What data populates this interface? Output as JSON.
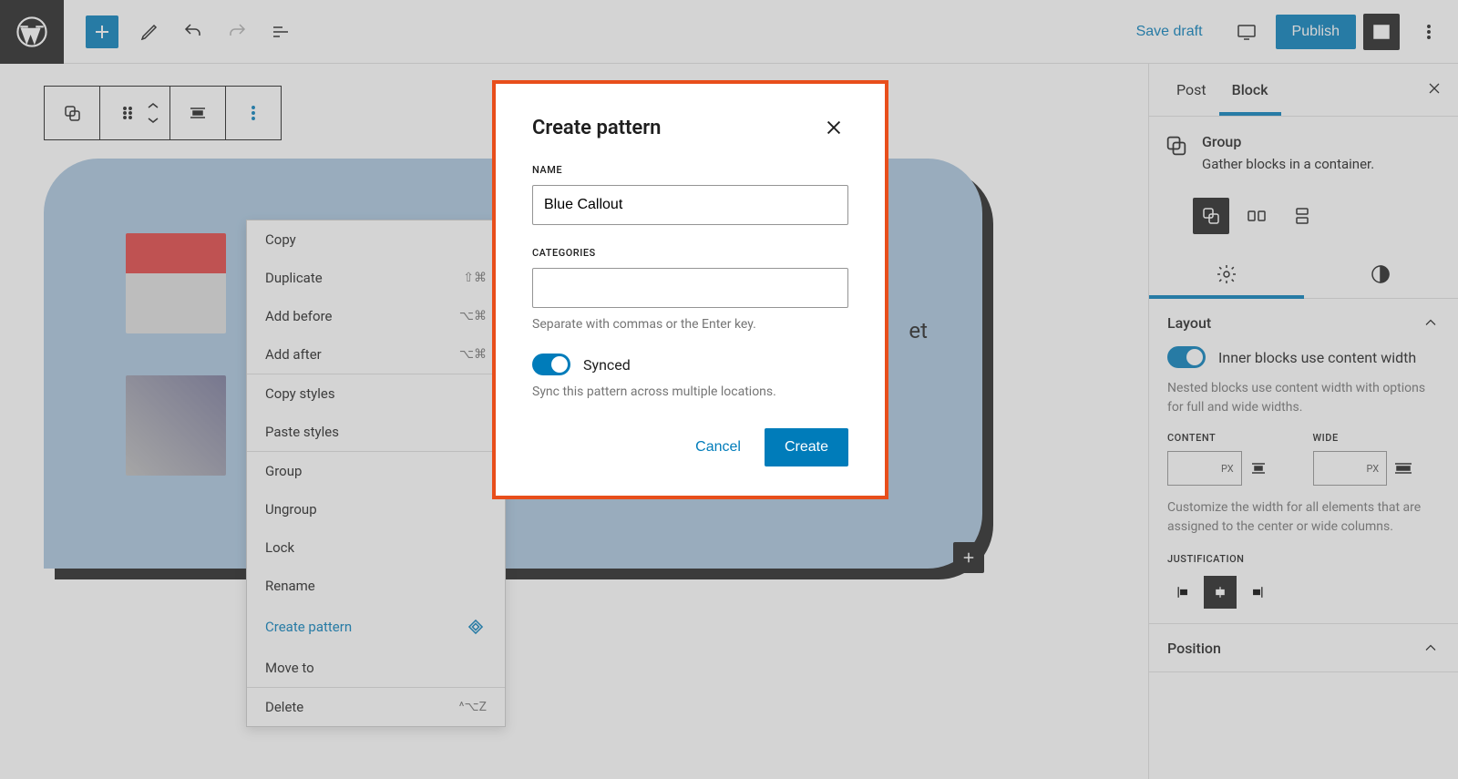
{
  "topbar": {
    "save_draft": "Save draft",
    "publish": "Publish"
  },
  "ctx": {
    "copy": "Copy",
    "duplicate": "Duplicate",
    "duplicate_key": "⇧⌘",
    "add_before": "Add before",
    "add_before_key": "⌥⌘",
    "add_after": "Add after",
    "add_after_key": "⌥⌘",
    "copy_styles": "Copy styles",
    "paste_styles": "Paste styles",
    "group": "Group",
    "ungroup": "Ungroup",
    "lock": "Lock",
    "rename": "Rename",
    "create_pattern": "Create pattern",
    "move_to": "Move to",
    "delete": "Delete",
    "delete_key": "^⌥Z"
  },
  "canvas": {
    "sample_text": "et"
  },
  "modal": {
    "title": "Create pattern",
    "name_label": "NAME",
    "name_value": "Blue Callout",
    "categories_label": "CATEGORIES",
    "categories_help": "Separate with commas or the Enter key.",
    "synced_label": "Synced",
    "synced_help": "Sync this pattern across multiple locations.",
    "cancel": "Cancel",
    "create": "Create"
  },
  "sidebar": {
    "tab_post": "Post",
    "tab_block": "Block",
    "block_name": "Group",
    "block_desc": "Gather blocks in a container.",
    "layout_title": "Layout",
    "inner_width_label": "Inner blocks use content width",
    "inner_width_desc": "Nested blocks use content width with options for full and wide widths.",
    "content_label": "CONTENT",
    "wide_label": "WIDE",
    "px": "PX",
    "width_desc": "Customize the width for all elements that are assigned to the center or wide columns.",
    "justification_label": "JUSTIFICATION",
    "position_title": "Position"
  }
}
